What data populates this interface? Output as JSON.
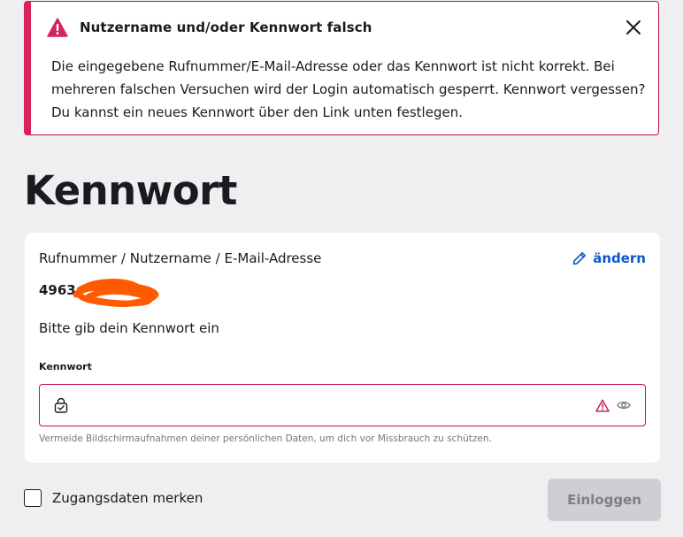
{
  "alert": {
    "title": "Nutzername und/oder Kennwort falsch",
    "body_lines": [
      "Die eingegebene Rufnummer/E-Mail-Adresse oder das Kennwort ist nicht korrekt. Bei",
      "mehreren falschen Versuchen wird der Login automatisch gesperrt. Kennwort vergessen?",
      "Du kannst ein neues Kennwort über den Link unten festlegen."
    ],
    "icon": "warning-triangle-icon",
    "close_icon": "close-icon",
    "accent_color": "#d4245a"
  },
  "page": {
    "title": "Kennwort"
  },
  "card": {
    "identifier_label": "Rufnummer / Nutzername / E-Mail-Adresse",
    "change_label": "ändern",
    "change_icon": "pencil-icon",
    "identifier_value": "4963",
    "prompt": "Bitte gib dein Kennwort ein",
    "password_label": "Kennwort",
    "password_value": "",
    "password_placeholder": "",
    "hint": "Vermeide Bildschirmaufnahmen deiner persönlichen Daten, um dich vor Missbrauch zu schützen."
  },
  "footer": {
    "remember_label": "Zugangsdaten merken",
    "remember_checked": false,
    "login_label": "Einloggen"
  },
  "colors": {
    "background": "#efeff1",
    "error": "#c3104a",
    "link": "#0d57c9",
    "button_disabled": "#cfcfd3",
    "redaction": "#ff5a00"
  }
}
